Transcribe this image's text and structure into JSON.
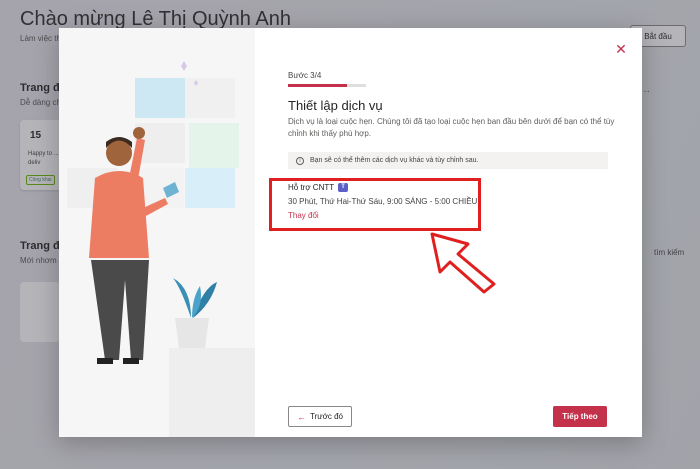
{
  "background": {
    "title": "Chào mừng Lê Thị Quỳnh Anh",
    "subtitle": "Làm việc th",
    "start_button": "Bắt đầu",
    "section1_title": "Trang đặ",
    "section1_sub": "Dễ dàng ch",
    "more": "···",
    "card_day": "15",
    "card_text": "Happy to ... can't deliv",
    "card_tag": "Công khai",
    "section2_title": "Trang đặ",
    "section2_sub": "Mới nhơm",
    "search_label": "tìm kiếm"
  },
  "modal": {
    "close_icon": "✕",
    "step": "Bước 3/4",
    "progress_percent": 75,
    "heading": "Thiết lập dịch vụ",
    "description": "Dịch vụ là loại cuộc hẹn. Chúng tôi đã tạo loại cuộc hẹn ban đầu bên dưới để bạn có thể tùy chỉnh khi thấy phù hợp.",
    "info_icon": "i",
    "info_text": "Bạn sẽ có thể thêm các dịch vụ khác và tùy chỉnh sau.",
    "service": {
      "name": "Hỗ trợ CNTT",
      "teams_icon": "T",
      "detail": "30 Phút, Thứ Hai-Thứ Sáu, 9:00 SÁNG - 5:00 CHIỀU",
      "change_link": "Thay đổi"
    },
    "back_icon": "←",
    "back_button": "Trước đó",
    "next_button": "Tiếp theo"
  },
  "colors": {
    "accent": "#c4314b",
    "highlight": "#e0201f"
  }
}
